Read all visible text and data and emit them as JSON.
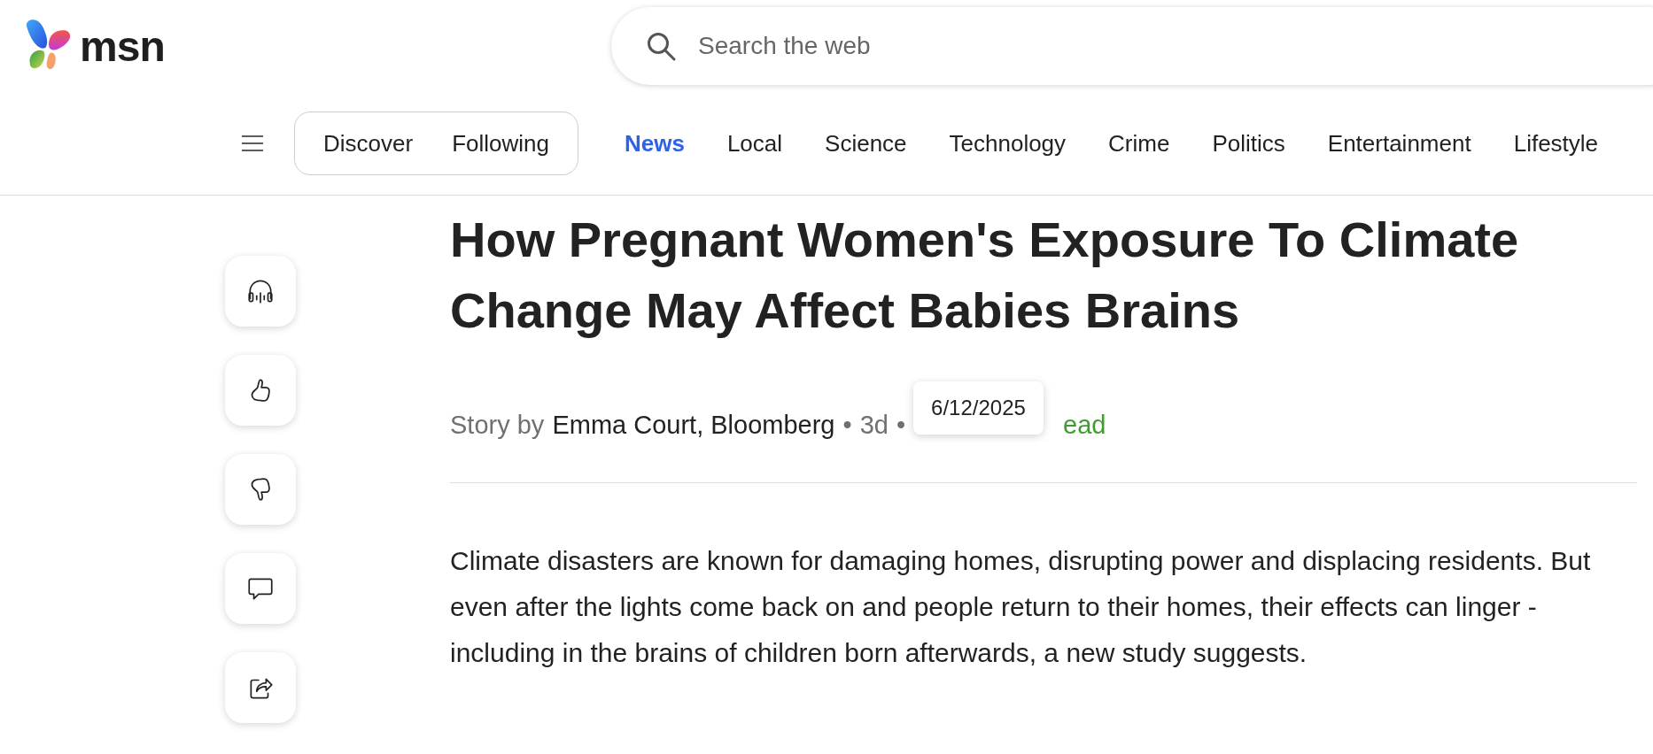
{
  "logo": {
    "text": "msn"
  },
  "search": {
    "placeholder": "Search the web"
  },
  "feed_toggle": [
    {
      "label": "Discover",
      "selected": false
    },
    {
      "label": "Following",
      "selected": false
    }
  ],
  "categories": [
    {
      "label": "News",
      "selected": true
    },
    {
      "label": "Local",
      "selected": false
    },
    {
      "label": "Science",
      "selected": false
    },
    {
      "label": "Technology",
      "selected": false
    },
    {
      "label": "Crime",
      "selected": false
    },
    {
      "label": "Politics",
      "selected": false
    },
    {
      "label": "Entertainment",
      "selected": false
    },
    {
      "label": "Lifestyle",
      "selected": false
    }
  ],
  "side_actions": [
    {
      "kind": "listen"
    },
    {
      "kind": "like"
    },
    {
      "kind": "dislike"
    },
    {
      "kind": "comment"
    },
    {
      "kind": "share"
    }
  ],
  "article": {
    "title": "How Pregnant Women's Exposure To Climate Change May Affect Babies Brains",
    "byline": {
      "prefix": "Story by",
      "author": "Emma Court, Bloomberg",
      "separator_1": "•",
      "age": "3d",
      "separator_2": "•",
      "read_time": "ead"
    },
    "tooltip": "6/12/2025",
    "paragraph": "Climate disasters are known for damaging homes, disrupting power and displacing residents. But even after the lights come back on and people return to their homes, their effects can linger - including in the brains of children born afterwards, a new study suggests."
  }
}
